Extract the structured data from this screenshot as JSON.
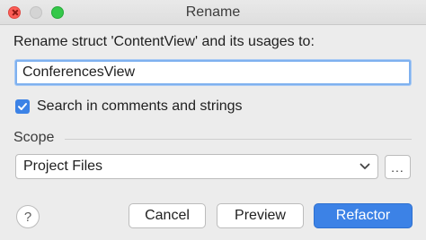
{
  "window": {
    "title": "Rename"
  },
  "dialog": {
    "prompt": "Rename struct 'ContentView' and its usages to:",
    "new_name": "ConferencesView",
    "search_checkbox": {
      "label": "Search in comments and strings",
      "checked": true
    },
    "scope": {
      "label": "Scope",
      "selected": "Project Files",
      "browse_label": "..."
    }
  },
  "buttons": {
    "help": "?",
    "cancel": "Cancel",
    "preview": "Preview",
    "refactor": "Refactor"
  },
  "icons": {
    "close": "close-icon",
    "minimize": "minimize-icon",
    "maximize": "maximize-icon",
    "checkbox": "checkmark-icon",
    "dropdown": "chevron-down-icon"
  },
  "colors": {
    "accent": "#3c82e6"
  }
}
